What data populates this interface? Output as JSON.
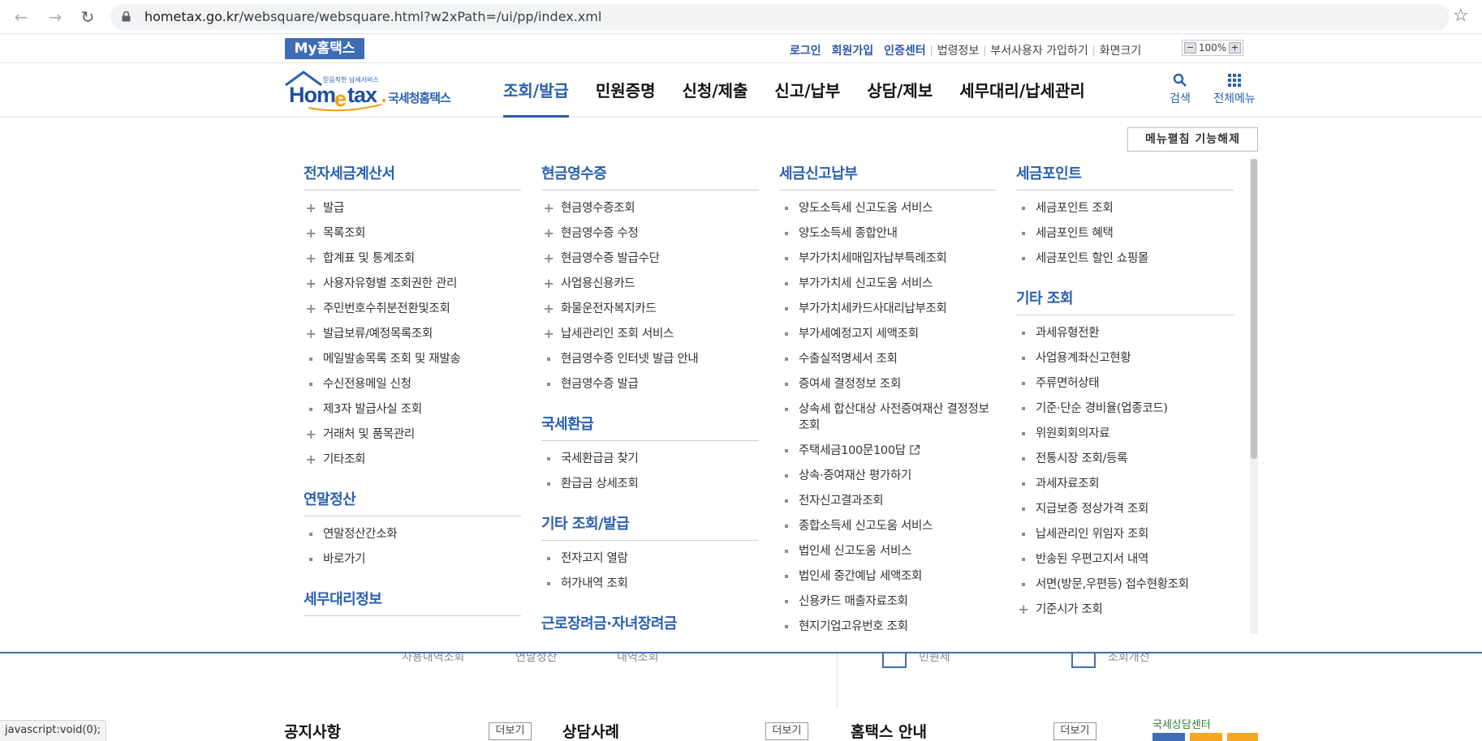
{
  "browser": {
    "url_host": "hometax.go.kr",
    "url_path": "/websquare/websquare.html?w2xPath=/ui/pp/index.xml"
  },
  "util": {
    "my_hometax": "My홈택스",
    "links": [
      "로그인",
      "회원가입",
      "인증센터"
    ],
    "plain_links": [
      "법령정보",
      "부서사용자 가입하기",
      "화면크기"
    ],
    "zoom_level": "100%"
  },
  "header": {
    "logo_tagline": "믿음직한 납세서비스",
    "logo_name": "국세청홈택스",
    "tabs": [
      "조회/발급",
      "민원증명",
      "신청/제출",
      "신고/납부",
      "상담/제보",
      "세무대리/납세관리"
    ],
    "search_label": "검색",
    "all_menu_label": "전체메뉴"
  },
  "mega": {
    "fold_button": "메뉴펼침 기능해제",
    "columns": [
      [
        {
          "title": "전자세금계산서",
          "items": [
            {
              "label": "발급",
              "marker": "plus"
            },
            {
              "label": "목록조회",
              "marker": "plus"
            },
            {
              "label": "합계표 및 통계조회",
              "marker": "plus"
            },
            {
              "label": "사용자유형별 조회권한 관리",
              "marker": "plus"
            },
            {
              "label": "주민번호수취분전환및조회",
              "marker": "plus"
            },
            {
              "label": "발급보류/예정목록조회",
              "marker": "plus"
            },
            {
              "label": "메일발송목록 조회 및 재발송",
              "marker": "square"
            },
            {
              "label": "수신전용메일 신청",
              "marker": "square"
            },
            {
              "label": "제3자 발급사실 조회",
              "marker": "square"
            },
            {
              "label": "거래처 및 품목관리",
              "marker": "plus"
            },
            {
              "label": "기타조회",
              "marker": "plus"
            }
          ]
        },
        {
          "title": "연말정산",
          "items": [
            {
              "label": "연말정산간소화",
              "marker": "square"
            },
            {
              "label": "바로가기",
              "marker": "square"
            }
          ]
        },
        {
          "title": "세무대리정보",
          "items": []
        }
      ],
      [
        {
          "title": "현금영수증",
          "items": [
            {
              "label": "현금영수증조회",
              "marker": "plus"
            },
            {
              "label": "현금영수증 수정",
              "marker": "plus"
            },
            {
              "label": "현금영수증 발급수단",
              "marker": "plus"
            },
            {
              "label": "사업용신용카드",
              "marker": "plus"
            },
            {
              "label": "화물운전자복지카드",
              "marker": "plus"
            },
            {
              "label": "납세관리인 조회 서비스",
              "marker": "plus"
            },
            {
              "label": "현금영수증 인터넷 발급 안내",
              "marker": "square"
            },
            {
              "label": "현금영수증 발급",
              "marker": "square"
            }
          ]
        },
        {
          "title": "국세환급",
          "items": [
            {
              "label": "국세환급금 찾기",
              "marker": "square"
            },
            {
              "label": "환급금 상세조회",
              "marker": "square"
            }
          ]
        },
        {
          "title": "기타 조회/발급",
          "items": [
            {
              "label": "전자고지 열람",
              "marker": "square"
            },
            {
              "label": "허가내역 조회",
              "marker": "square"
            }
          ]
        },
        {
          "title": "근로장려금·자녀장려금",
          "items": []
        }
      ],
      [
        {
          "title": "세금신고납부",
          "items": [
            {
              "label": "양도소득세 신고도움 서비스",
              "marker": "square"
            },
            {
              "label": "양도소득세 종합안내",
              "marker": "square"
            },
            {
              "label": "부가가치세매입자납부특례조회",
              "marker": "square"
            },
            {
              "label": "부가가치세 신고도움 서비스",
              "marker": "square"
            },
            {
              "label": "부가가치세카드사대리납부조회",
              "marker": "square"
            },
            {
              "label": "부가세예정고지 세액조회",
              "marker": "square"
            },
            {
              "label": "수출실적명세서 조회",
              "marker": "square"
            },
            {
              "label": "증여세 결정정보 조회",
              "marker": "square"
            },
            {
              "label": "상속세 합산대상 사전증여재산 결정정보 조회",
              "marker": "square"
            },
            {
              "label": "주택세금100문100답",
              "marker": "square",
              "external": true
            },
            {
              "label": "상속·증여재산 평가하기",
              "marker": "square"
            },
            {
              "label": "전자신고결과조회",
              "marker": "square"
            },
            {
              "label": "종합소득세 신고도움 서비스",
              "marker": "square"
            },
            {
              "label": "법인세 신고도움 서비스",
              "marker": "square"
            },
            {
              "label": "법인세 중간예납 세액조회",
              "marker": "square"
            },
            {
              "label": "신용카드 매출자료조회",
              "marker": "square"
            },
            {
              "label": "현지기업고유번호 조회",
              "marker": "square"
            }
          ]
        }
      ],
      [
        {
          "title": "세금포인트",
          "items": [
            {
              "label": "세금포인트 조회",
              "marker": "square"
            },
            {
              "label": "세금포인트 혜택",
              "marker": "square"
            },
            {
              "label": "세금포인트 할인 쇼핑몰",
              "marker": "square"
            }
          ]
        },
        {
          "title": "기타 조회",
          "items": [
            {
              "label": "과세유형전환",
              "marker": "square"
            },
            {
              "label": "사업용계좌신고현황",
              "marker": "square"
            },
            {
              "label": "주류면허상태",
              "marker": "square"
            },
            {
              "label": "기준·단순 경비율(업종코드)",
              "marker": "square"
            },
            {
              "label": "위원회회의자료",
              "marker": "square"
            },
            {
              "label": "전통시장 조회/등록",
              "marker": "square"
            },
            {
              "label": "과세자료조회",
              "marker": "square"
            },
            {
              "label": "지급보증 정상가격 조회",
              "marker": "square"
            },
            {
              "label": "납세관리인 위임자 조회",
              "marker": "square"
            },
            {
              "label": "반송된 우편고지서 내역",
              "marker": "square"
            },
            {
              "label": "서면(방문,우편등) 접수현황조회",
              "marker": "square"
            },
            {
              "label": "기준시가 조회",
              "marker": "plus"
            }
          ]
        }
      ]
    ]
  },
  "peek": {
    "texts": [
      "사용내역조회",
      "연말정산",
      "내역조회",
      "민원세",
      "조회개선"
    ]
  },
  "status_bar": "javascript:void(0);",
  "boards": {
    "notice": "공지사항",
    "counsel": "상담사례",
    "guide": "홈택스 안내",
    "more_label": "더보기"
  },
  "center_logo_text": "국세상담센터"
}
